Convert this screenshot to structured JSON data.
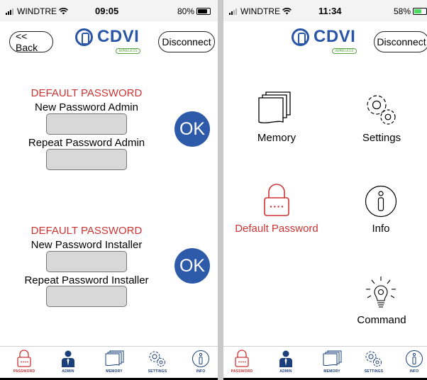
{
  "colors": {
    "brand_blue": "#2855a5",
    "accent_red": "#cc3333",
    "ok_blue": "#2e5aaa",
    "field_gray": "#d8d8d8"
  },
  "left": {
    "status": {
      "carrier": "WINDTRE",
      "time": "09:05",
      "battery": "80%"
    },
    "nav": {
      "back": "<< Back",
      "disconnect": "Disconnect"
    },
    "logo": {
      "word": "CDVI",
      "tag": "WIRELESS"
    },
    "admin": {
      "heading": "DEFAULT PASSWORD",
      "new_label": "New Password Admin",
      "repeat_label": "Repeat Password Admin",
      "ok": "OK"
    },
    "installer": {
      "heading": "DEFAULT PASSWORD",
      "new_label": "New Password Installer",
      "repeat_label": "Repeat Password Installer",
      "ok": "OK"
    }
  },
  "right": {
    "status": {
      "carrier": "WINDTRE",
      "time": "11:34",
      "battery": "58%"
    },
    "nav": {
      "disconnect": "Disconnect"
    },
    "logo": {
      "word": "CDVI",
      "tag": "WIRELESS"
    },
    "tiles": {
      "memory": "Memory",
      "settings": "Settings",
      "default_password": "Default Password",
      "info": "Info",
      "command": "Command"
    }
  },
  "tabbar": {
    "password": "PASSWORD",
    "admin": "ADMIN",
    "memory": "MEMORY",
    "settings": "SETTINGS",
    "info": "INFO"
  },
  "icons": [
    "padlock-icon",
    "person-icon",
    "stacked-documents-icon",
    "gears-icon",
    "info-icon",
    "lightbulb-icon",
    "wifi-icon",
    "battery-icon"
  ]
}
